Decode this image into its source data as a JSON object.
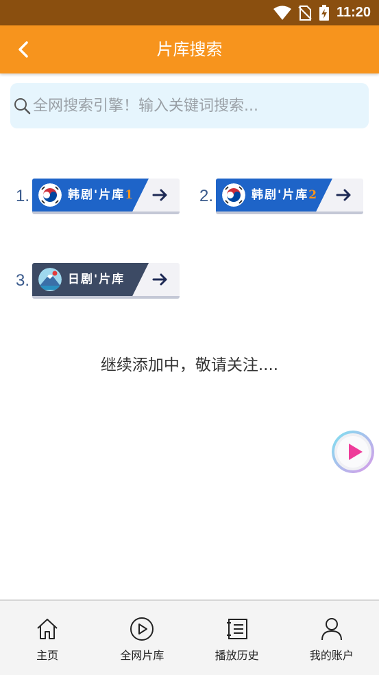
{
  "status_bar": {
    "time": "11:20",
    "icons": [
      "wifi-icon",
      "no-sim-icon",
      "battery-charging-icon"
    ]
  },
  "header": {
    "title": "片库搜索",
    "back_icon": "chevron-left-icon"
  },
  "search": {
    "placeholder": "全网搜索引擎！输入关键词搜索...",
    "value": ""
  },
  "libraries": [
    {
      "number": "1.",
      "name": "韩剧'片库",
      "suffix": "1",
      "flag": "korea-flag-icon"
    },
    {
      "number": "2.",
      "name": "韩剧'片库",
      "suffix": "2",
      "flag": "korea-flag-icon"
    },
    {
      "number": "3.",
      "name": "日剧'片库",
      "suffix": "",
      "flag": "japan-mount-fuji-icon"
    }
  ],
  "notice": "继续添加中，敬请关注....",
  "bottom_nav": [
    {
      "label": "主页",
      "icon": "home-icon"
    },
    {
      "label": "全网片库",
      "icon": "play-circle-icon"
    },
    {
      "label": "播放历史",
      "icon": "history-list-icon"
    },
    {
      "label": "我的账户",
      "icon": "user-icon"
    }
  ],
  "colors": {
    "header": "#f7941d",
    "status_bar": "#8a4f0f",
    "korea_card": "#1e64c8",
    "japan_card": "#3c4a64",
    "search_bg": "#e6f5fd"
  }
}
